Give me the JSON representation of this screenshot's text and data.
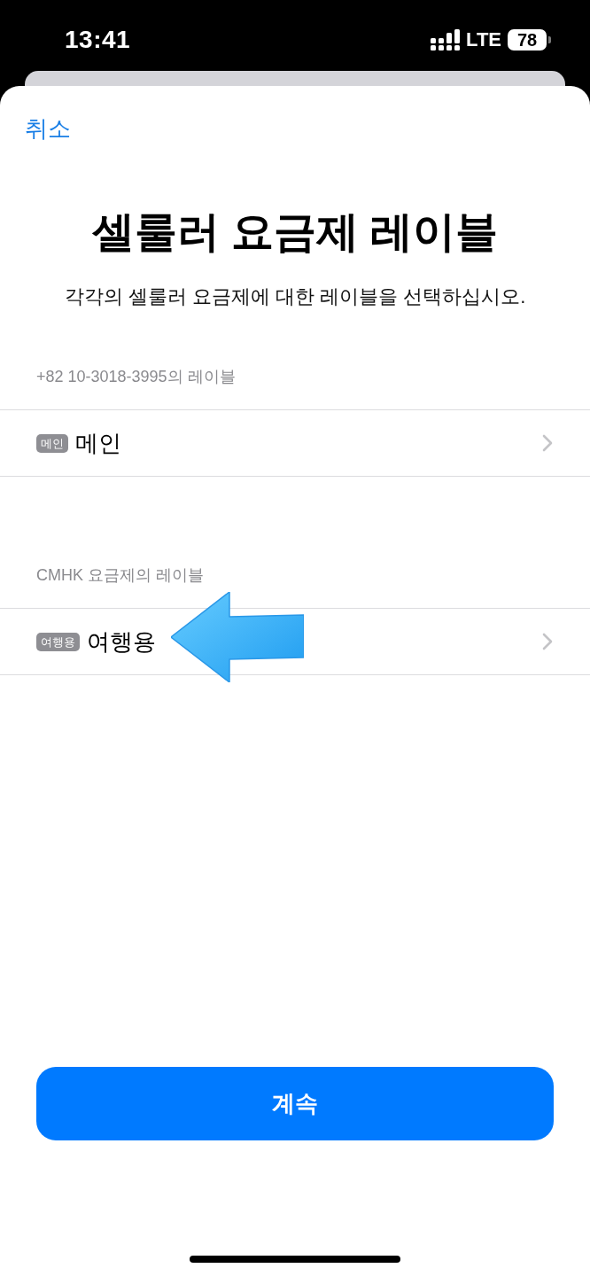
{
  "status_bar": {
    "time": "13:41",
    "network": "LTE",
    "battery": "78"
  },
  "sheet": {
    "cancel": "취소",
    "title": "셀룰러 요금제 레이블",
    "subtitle": "각각의 셀룰러 요금제에 대한 레이블을 선택하십시오."
  },
  "sections": [
    {
      "header": "+82 10-3018-3995의 레이블",
      "rows": [
        {
          "tag": "메인",
          "label": "메인",
          "annotated": false
        }
      ]
    },
    {
      "header": "CMHK 요금제의 레이블",
      "rows": [
        {
          "tag": "여행용",
          "label": "여행용",
          "annotated": true
        }
      ]
    }
  ],
  "continue_button": "계속"
}
